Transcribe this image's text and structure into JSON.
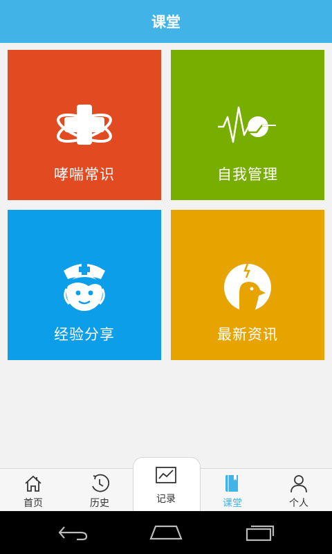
{
  "header": {
    "title": "课堂"
  },
  "tiles": [
    {
      "label": "哮喘常识",
      "icon": "medical-cross-icon",
      "color": "#e24a22"
    },
    {
      "label": "自我管理",
      "icon": "heartbeat-chart-icon",
      "color": "#78ae00"
    },
    {
      "label": "经验分享",
      "icon": "nurse-face-icon",
      "color": "#0d9ee9"
    },
    {
      "label": "最新资讯",
      "icon": "bird-news-icon",
      "color": "#e7a400"
    }
  ],
  "tabbar": {
    "items": [
      {
        "label": "首页",
        "icon": "home-icon"
      },
      {
        "label": "历史",
        "icon": "history-icon"
      },
      {
        "label": "记录",
        "icon": "chart-record-icon"
      },
      {
        "label": "课堂",
        "icon": "book-icon",
        "active": true
      },
      {
        "label": "个人",
        "icon": "person-icon"
      }
    ],
    "active_color": "#41b3e6"
  },
  "system_nav": [
    "back-icon",
    "home-nav-icon",
    "recent-apps-icon"
  ]
}
